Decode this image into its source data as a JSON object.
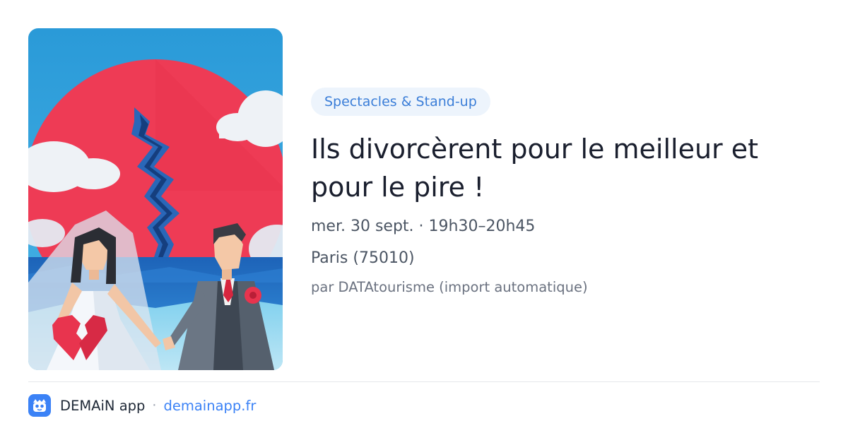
{
  "event": {
    "category": "Spectacles & Stand-up",
    "title": "Ils divorcèrent pour le meilleur et pour le pire !",
    "datetime": "mer. 30 sept. · 19h30–20h45",
    "location": "Paris (75010)",
    "source": "par DATAtourisme (import automatique)"
  },
  "footer": {
    "app_name": "DEMAiN app",
    "separator": "·",
    "domain": "demainapp.fr"
  },
  "icons": {
    "app_logo": "demain-app-logo-icon"
  },
  "colors": {
    "accent": "#3b82f6",
    "pill_background": "#edf4fc",
    "pill_text": "#3b7ed8",
    "title": "#1a1f2e",
    "meta": "#4b5563",
    "muted": "#6b7280"
  }
}
